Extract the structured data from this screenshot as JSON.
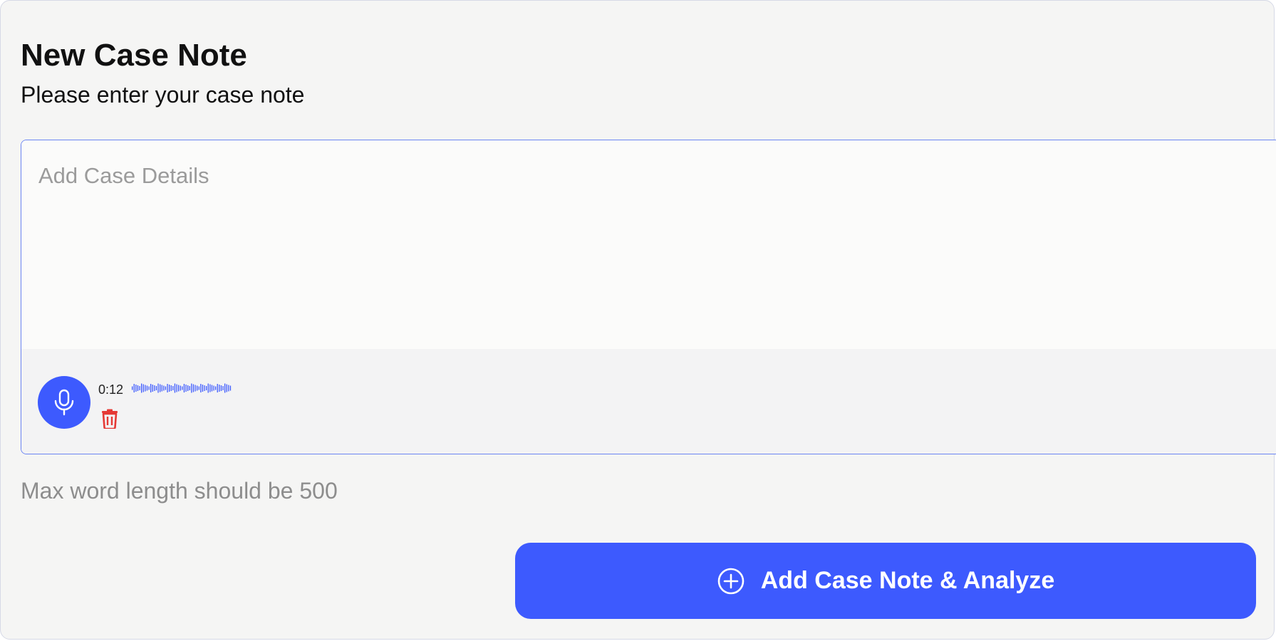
{
  "form": {
    "title": "New Case Note",
    "subtitle": "Please enter your case note",
    "input_placeholder": "Add Case Details",
    "input_value": "",
    "hint": "Max word length should be 500"
  },
  "recorder": {
    "duration": "0:12",
    "mic_icon": "microphone-icon",
    "delete_icon": "trash-icon",
    "waveform_icon": "waveform-icon"
  },
  "actions": {
    "submit_label": "Add Case Note & Analyze",
    "submit_icon": "plus-circle-icon"
  },
  "colors": {
    "accent": "#3d5afe",
    "focus_border": "#6b85f2",
    "delete": "#e53935",
    "hint_text": "#8d8d8d"
  }
}
